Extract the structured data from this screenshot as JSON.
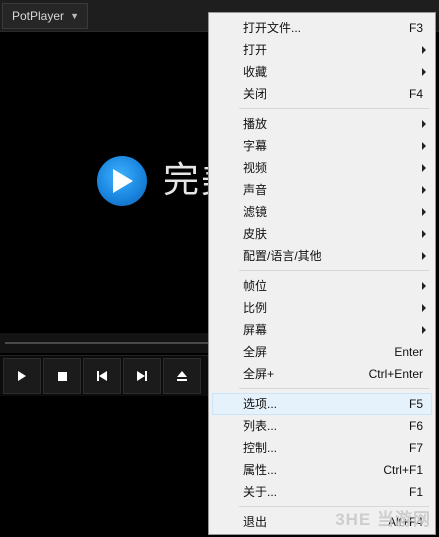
{
  "app": {
    "name": "PotPlayer"
  },
  "splash": {
    "text": "完美"
  },
  "menu": {
    "groups": [
      [
        {
          "label": "打开文件...",
          "shortcut": "F3",
          "submenu": false
        },
        {
          "label": "打开",
          "shortcut": "",
          "submenu": true
        },
        {
          "label": "收藏",
          "shortcut": "",
          "submenu": true
        },
        {
          "label": "关闭",
          "shortcut": "F4",
          "submenu": false
        }
      ],
      [
        {
          "label": "播放",
          "shortcut": "",
          "submenu": true
        },
        {
          "label": "字幕",
          "shortcut": "",
          "submenu": true
        },
        {
          "label": "视频",
          "shortcut": "",
          "submenu": true
        },
        {
          "label": "声音",
          "shortcut": "",
          "submenu": true
        },
        {
          "label": "滤镜",
          "shortcut": "",
          "submenu": true
        },
        {
          "label": "皮肤",
          "shortcut": "",
          "submenu": true
        },
        {
          "label": "配置/语言/其他",
          "shortcut": "",
          "submenu": true
        }
      ],
      [
        {
          "label": "帧位",
          "shortcut": "",
          "submenu": true
        },
        {
          "label": "比例",
          "shortcut": "",
          "submenu": true
        },
        {
          "label": "屏幕",
          "shortcut": "",
          "submenu": true
        },
        {
          "label": "全屏",
          "shortcut": "Enter",
          "submenu": false
        },
        {
          "label": "全屏+",
          "shortcut": "Ctrl+Enter",
          "submenu": false
        }
      ],
      [
        {
          "label": "选项...",
          "shortcut": "F5",
          "submenu": false,
          "highlighted": true
        },
        {
          "label": "列表...",
          "shortcut": "F6",
          "submenu": false
        },
        {
          "label": "控制...",
          "shortcut": "F7",
          "submenu": false
        },
        {
          "label": "属性...",
          "shortcut": "Ctrl+F1",
          "submenu": false
        },
        {
          "label": "关于...",
          "shortcut": "F1",
          "submenu": false
        }
      ],
      [
        {
          "label": "退出",
          "shortcut": "Alt+F4",
          "submenu": false
        }
      ]
    ]
  },
  "controls": [
    "play-icon",
    "stop-icon",
    "previous-icon",
    "next-icon",
    "eject-icon"
  ],
  "watermark": {
    "text": "3HE 当游网"
  },
  "colors": {
    "menu_bg": "#f0f0f0",
    "highlight_bg": "#e5f1fb",
    "logo_blue": "#1a86e0"
  }
}
